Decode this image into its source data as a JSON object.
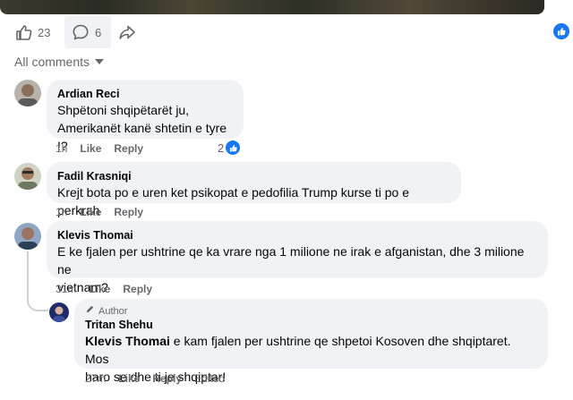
{
  "post_actions": {
    "like_count": "23",
    "comment_count": "6"
  },
  "filter": {
    "label": "All comments"
  },
  "comments": [
    {
      "author": "Ardian Reci",
      "text_lines": [
        "Shpëtoni shqipëtarët ju,",
        "Amerikanët kanë shtetin e tyre !?"
      ],
      "time": "1h",
      "like": "Like",
      "reply": "Reply",
      "reactions": "2"
    },
    {
      "author": "Fadil Krasniqi",
      "text_lines": [
        "Krejt bota po e uren ket psikopat e pedofilia Trump kurse ti po e perkrah"
      ],
      "time": "1h",
      "like": "Like",
      "reply": "Reply"
    },
    {
      "author": "Klevis Thomai",
      "text_lines": [
        "E ke fjalen per ushtrine qe ka vrare nga 1 milione ne irak e afganistan, dhe 3 milione ne",
        "vietnam?"
      ],
      "time": "31m",
      "like": "Like",
      "reply": "Reply"
    }
  ],
  "reply": {
    "badge": "Author",
    "author": "Tritan Shehu",
    "mention": "Klevis Thomai",
    "text_after_mention": " e kam fjalen per ushtrine qe shpetoi Kosoven dhe shqiptaret. Mos",
    "text_line2": "haro se dhe ti je shqiptar!",
    "time": "27m",
    "like": "Like",
    "reply": "Reply",
    "edited": "Edited"
  },
  "colors": {
    "accent": "#1877f2",
    "bubble": "#f0f2f5",
    "secondary_text": "#65676b"
  },
  "icons": [
    "like-icon",
    "comment-icon",
    "share-icon",
    "caret-down-icon",
    "pencil-icon"
  ]
}
